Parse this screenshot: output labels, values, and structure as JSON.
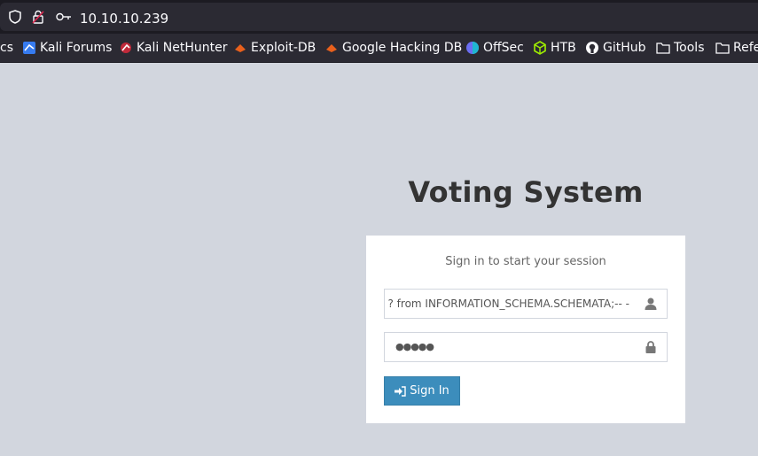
{
  "browser": {
    "url": "10.10.10.239",
    "bookmarks": [
      "cs",
      "Kali Forums",
      "Kali NetHunter",
      "Exploit-DB",
      "Google Hacking DB",
      "OffSec",
      "HTB",
      "GitHub",
      "Tools",
      "Refe"
    ]
  },
  "page": {
    "title": "Voting System",
    "login_message": "Sign in to start your session",
    "username_value": "? from INFORMATION_SCHEMA.SCHEMATA;-- -",
    "password_value": "●●●●●",
    "signin_label": "Sign In"
  },
  "colors": {
    "accent": "#3c8dbc",
    "background": "#d2d6de"
  }
}
